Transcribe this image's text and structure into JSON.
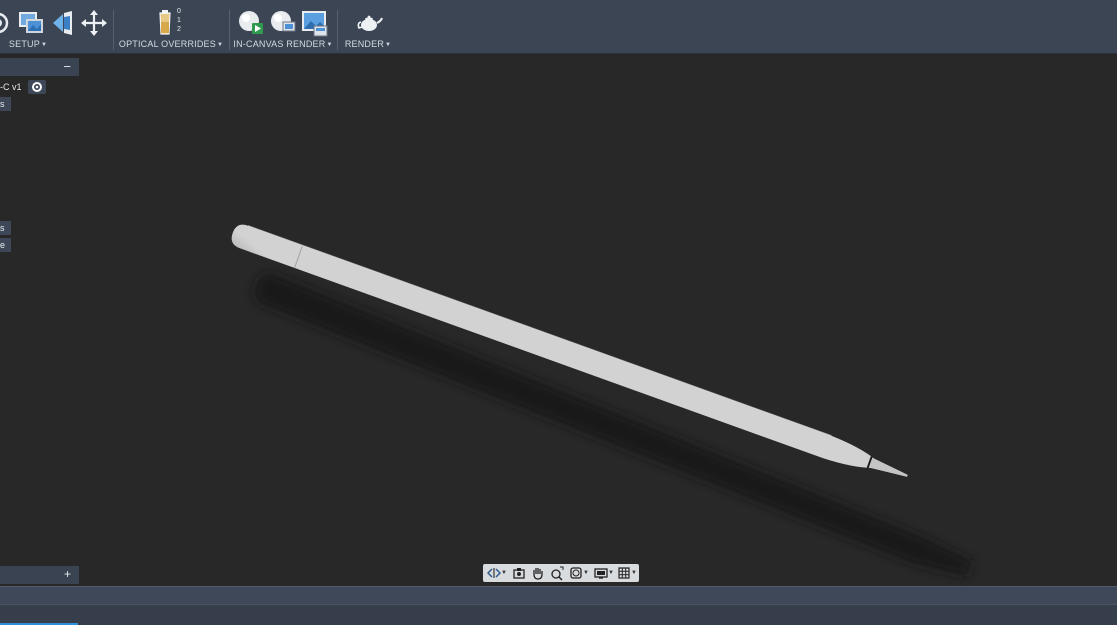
{
  "toolbar": {
    "groups": [
      {
        "label": "SETUP"
      },
      {
        "label": "OPTICAL OVERRIDES"
      },
      {
        "label": "IN-CANVAS RENDER"
      },
      {
        "label": "RENDER"
      }
    ],
    "override_badge": {
      "top": "0",
      "mid": "1",
      "bottom": "2"
    }
  },
  "browser": {
    "collapse_label": "−",
    "root_label": "-C v1",
    "row_a": "s",
    "row_b": "s",
    "row_c": "e"
  },
  "comments": {
    "expand_label": "+"
  },
  "colors": {
    "accent": "#2f8ed8",
    "toolbar": "#3c4554",
    "canvas": "#282828"
  },
  "icons": [
    "scene-settings-icon",
    "environment-library-icon",
    "appearance-icon",
    "move-icon",
    "texture-map-icon",
    "in-canvas-render-icon",
    "in-canvas-settings-icon",
    "capture-image-icon",
    "render-teapot-icon",
    "orbit-icon",
    "look-at-icon",
    "pan-icon",
    "zoom-icon",
    "fit-icon",
    "display-settings-icon",
    "grid-icon"
  ]
}
